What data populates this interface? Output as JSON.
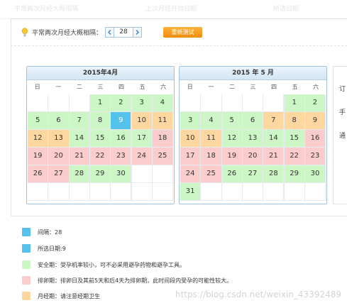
{
  "top": {
    "faint_left": "平常两次月经大概相隔",
    "faint_mid": "上次月经开始日期",
    "faint_right": "所选日期"
  },
  "cycle": {
    "label": "平常两次月经大概相隔：",
    "value": "28",
    "prev": "<",
    "next": ">",
    "button": "重新测试"
  },
  "weekdays": [
    "日",
    "一",
    "二",
    "三",
    "四",
    "五",
    "六"
  ],
  "calendars": [
    {
      "title": "2015年4月",
      "first_weekday": 3,
      "rows": 6,
      "days": [
        {
          "d": 1,
          "t": "safe"
        },
        {
          "d": 2,
          "t": "safe"
        },
        {
          "d": 3,
          "t": "safe"
        },
        {
          "d": 4,
          "t": "safe"
        },
        {
          "d": 5,
          "t": "safe"
        },
        {
          "d": 6,
          "t": "safe"
        },
        {
          "d": 7,
          "t": "safe"
        },
        {
          "d": 8,
          "t": "safe"
        },
        {
          "d": 9,
          "t": "sel"
        },
        {
          "d": 10,
          "t": "men"
        },
        {
          "d": 11,
          "t": "men"
        },
        {
          "d": 12,
          "t": "men"
        },
        {
          "d": 13,
          "t": "men"
        },
        {
          "d": 14,
          "t": "safe"
        },
        {
          "d": 15,
          "t": "safe"
        },
        {
          "d": 16,
          "t": "safe"
        },
        {
          "d": 17,
          "t": "safe"
        },
        {
          "d": 18,
          "t": "ov"
        },
        {
          "d": 19,
          "t": "ov"
        },
        {
          "d": 20,
          "t": "ov"
        },
        {
          "d": 21,
          "t": "ov"
        },
        {
          "d": 22,
          "t": "ov"
        },
        {
          "d": 23,
          "t": "ov"
        },
        {
          "d": 24,
          "t": "ov"
        },
        {
          "d": 25,
          "t": "ov"
        },
        {
          "d": 26,
          "t": "ov"
        },
        {
          "d": 27,
          "t": "ov"
        },
        {
          "d": 28,
          "t": "safe"
        },
        {
          "d": 29,
          "t": "safe"
        },
        {
          "d": 30,
          "t": "safe"
        }
      ]
    },
    {
      "title": "2015 年 5 月",
      "first_weekday": 5,
      "rows": 6,
      "days": [
        {
          "d": 1,
          "t": "safe"
        },
        {
          "d": 2,
          "t": "safe"
        },
        {
          "d": 3,
          "t": "safe"
        },
        {
          "d": 4,
          "t": "safe"
        },
        {
          "d": 5,
          "t": "safe"
        },
        {
          "d": 6,
          "t": "safe"
        },
        {
          "d": 7,
          "t": "men"
        },
        {
          "d": 8,
          "t": "men"
        },
        {
          "d": 9,
          "t": "men"
        },
        {
          "d": 10,
          "t": "men"
        },
        {
          "d": 11,
          "t": "men"
        },
        {
          "d": 12,
          "t": "safe"
        },
        {
          "d": 13,
          "t": "safe"
        },
        {
          "d": 14,
          "t": "safe"
        },
        {
          "d": 15,
          "t": "safe"
        },
        {
          "d": 16,
          "t": "ov"
        },
        {
          "d": 17,
          "t": "ov"
        },
        {
          "d": 18,
          "t": "ov"
        },
        {
          "d": 19,
          "t": "ov"
        },
        {
          "d": 20,
          "t": "ov"
        },
        {
          "d": 21,
          "t": "ov"
        },
        {
          "d": 22,
          "t": "ov"
        },
        {
          "d": 23,
          "t": "ov"
        },
        {
          "d": 24,
          "t": "ov"
        },
        {
          "d": 25,
          "t": "ov"
        },
        {
          "d": 26,
          "t": "safe"
        },
        {
          "d": 27,
          "t": "safe"
        },
        {
          "d": 28,
          "t": "safe"
        },
        {
          "d": 29,
          "t": "safe"
        },
        {
          "d": 30,
          "t": "safe"
        },
        {
          "d": 31,
          "t": "safe"
        }
      ]
    }
  ],
  "side_panel": [
    "订",
    "手",
    "通"
  ],
  "legend": [
    {
      "text": "间隔：28",
      "color": "#54c2ea"
    },
    {
      "text": "所选日期:9",
      "color": "#54c2ea"
    },
    {
      "text": "安全期：受孕机率较小，可不必采用避孕药物和避孕工具。",
      "color": "#cdf6c6"
    },
    {
      "text": "排卵期：排卵日及其前5天和后4天为排卵期，此时间段内受孕的可能性较大。",
      "color": "#fbcccc"
    },
    {
      "text": "月经期：请注意经期卫生",
      "color": "#fed69f"
    }
  ],
  "colors": {
    "safe": "#cdf6c6",
    "ovulation": "#fbcccc",
    "menstrual": "#fed69f",
    "selected": "#54c2ea",
    "accent_button": "#f6a020"
  },
  "icons": {
    "bulb": "lightbulb-icon",
    "prev": "chevron-left-icon",
    "next": "chevron-right-icon"
  },
  "watermark": "https://blog.csdn.net/weixin_43392489"
}
